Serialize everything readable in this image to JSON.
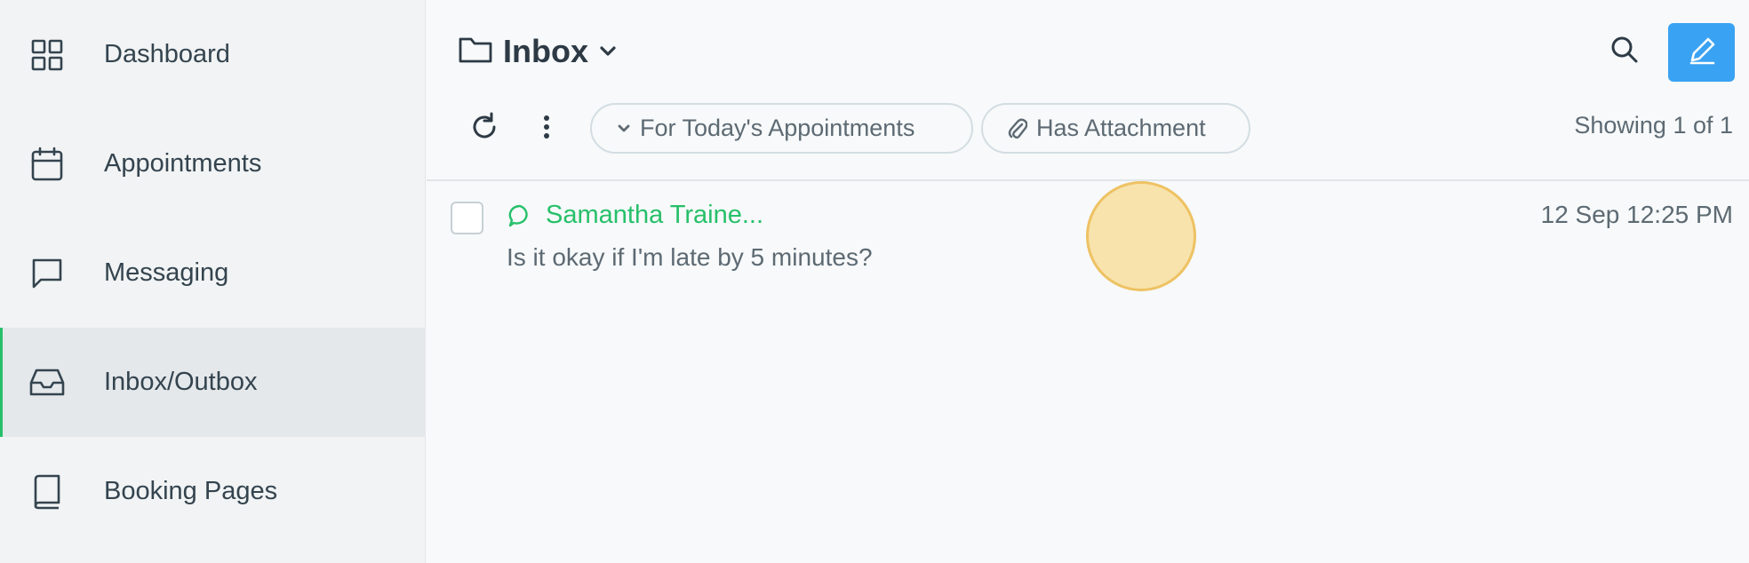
{
  "sidebar": {
    "items": [
      {
        "label": "Dashboard",
        "icon": "grid-icon"
      },
      {
        "label": "Appointments",
        "icon": "calendar-icon"
      },
      {
        "label": "Messaging",
        "icon": "chat-icon"
      },
      {
        "label": "Inbox/Outbox",
        "icon": "inbox-icon",
        "active": true
      },
      {
        "label": "Booking Pages",
        "icon": "book-icon"
      }
    ]
  },
  "header": {
    "title": "Inbox",
    "title_icon": "folder-icon"
  },
  "toolbar": {
    "filter_today": "For Today's Appointments",
    "filter_attachment": "Has Attachment",
    "showing": "Showing 1 of 1"
  },
  "messages": [
    {
      "sender": "Samantha Traine...",
      "time": "12 Sep 12:25 PM",
      "preview": "Is it okay if I'm late by 5 minutes?",
      "icon": "chat-bubble-icon"
    }
  ],
  "colors": {
    "accent_green": "#27c06a",
    "compose_blue": "#3aa2f2"
  }
}
